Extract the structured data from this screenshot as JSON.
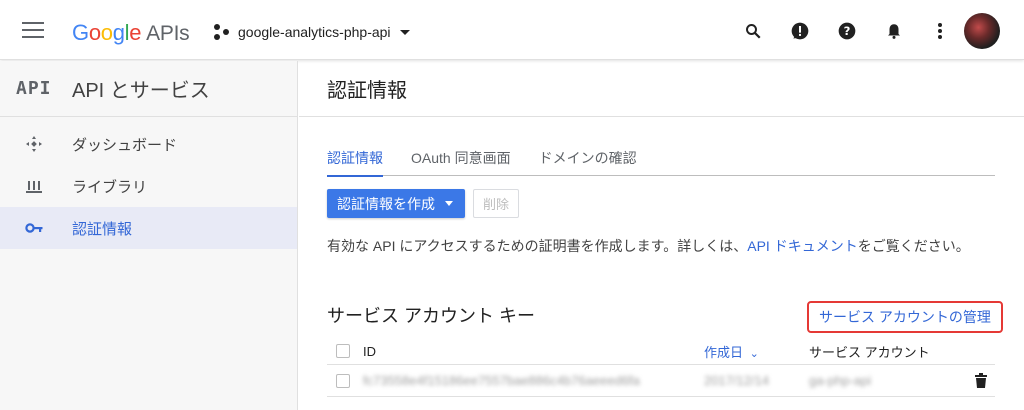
{
  "topbar": {
    "logo_letters": [
      "G",
      "o",
      "o",
      "g",
      "l",
      "e"
    ],
    "logo_suffix": "APIs",
    "project_name": "google-analytics-php-api",
    "icons": [
      "search-icon",
      "alert-icon",
      "help-icon",
      "notifications-icon",
      "more-vert-icon"
    ]
  },
  "sidebar": {
    "logo": "API",
    "title": "API とサービス",
    "items": [
      {
        "label": "ダッシュボード",
        "icon": "dashboard-icon",
        "active": false
      },
      {
        "label": "ライブラリ",
        "icon": "library-icon",
        "active": false
      },
      {
        "label": "認証情報",
        "icon": "key-icon",
        "active": true
      }
    ]
  },
  "main": {
    "title": "認証情報",
    "tabs": [
      {
        "label": "認証情報",
        "active": true
      },
      {
        "label": "OAuth 同意画面",
        "active": false
      },
      {
        "label": "ドメインの確認",
        "active": false
      }
    ],
    "create_button": "認証情報を作成",
    "delete_button": "削除",
    "description_before": "有効な API にアクセスするための証明書を作成します。詳しくは、",
    "description_link": "API ドキュメント",
    "description_after": "をご覧ください。",
    "section_title": "サービス アカウント キー",
    "manage_link": "サービス アカウントの管理",
    "table": {
      "headers": {
        "id": "ID",
        "date": "作成日",
        "account": "サービス アカウント"
      },
      "sort_indicator": "⌄",
      "rows": [
        {
          "id": "fc73558e4f15186ee7557bae886c4b76aeeed6fa",
          "date": "2017/12/14",
          "account": "ga-php-api"
        }
      ]
    }
  },
  "colors": {
    "accent": "#3367d6",
    "primary_button": "#3b78e7",
    "highlight_border": "#e53935",
    "sidebar_active_bg": "#e8eaf6"
  }
}
